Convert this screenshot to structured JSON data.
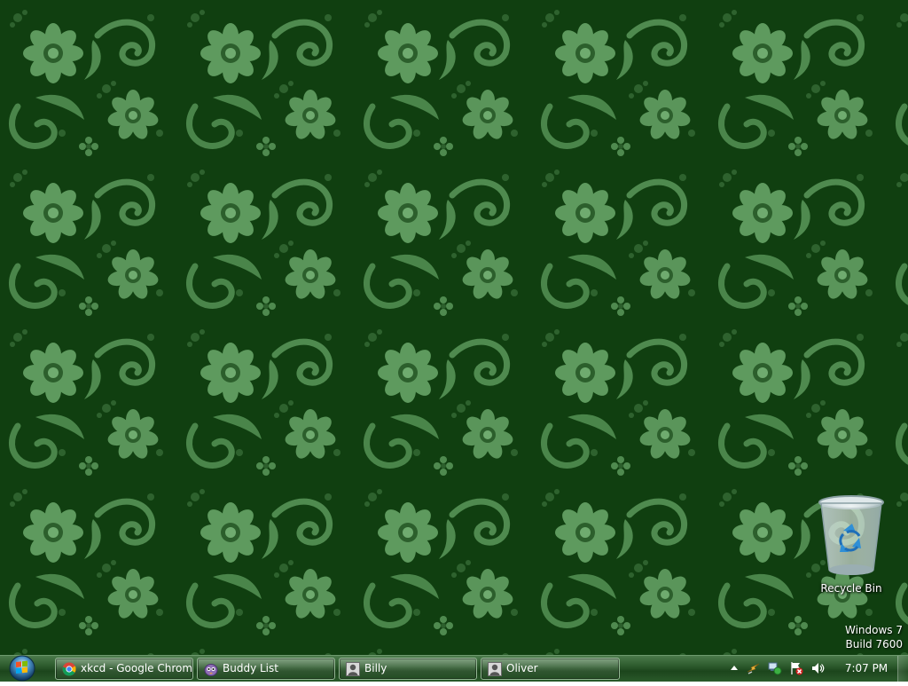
{
  "desktop": {
    "wallpaper_colors": {
      "background": "#0f3d0f",
      "pattern_light": "#5e9a5e",
      "pattern_mid": "#3f7a3f",
      "pattern_dark": "#1f541f"
    },
    "icons": [
      {
        "label": "Recycle Bin",
        "icon": "recycle-bin-icon"
      }
    ],
    "watermark": {
      "line1": "Windows 7",
      "line2": "Build 7600"
    }
  },
  "taskbar": {
    "start_icon": "windows-orb-icon",
    "buttons": [
      {
        "label": "xkcd - Google Chrome",
        "icon": "chrome-icon"
      },
      {
        "label": "Buddy List",
        "icon": "pidgin-icon"
      },
      {
        "label": "Billy",
        "icon": "chat-user-icon"
      },
      {
        "label": "Oliver",
        "icon": "chat-user-icon"
      }
    ],
    "tray": {
      "icons": [
        "show-hidden-icons-arrow",
        "power-icon",
        "network-icon",
        "action-center-icon",
        "volume-icon"
      ],
      "clock": "7:07 PM"
    }
  }
}
